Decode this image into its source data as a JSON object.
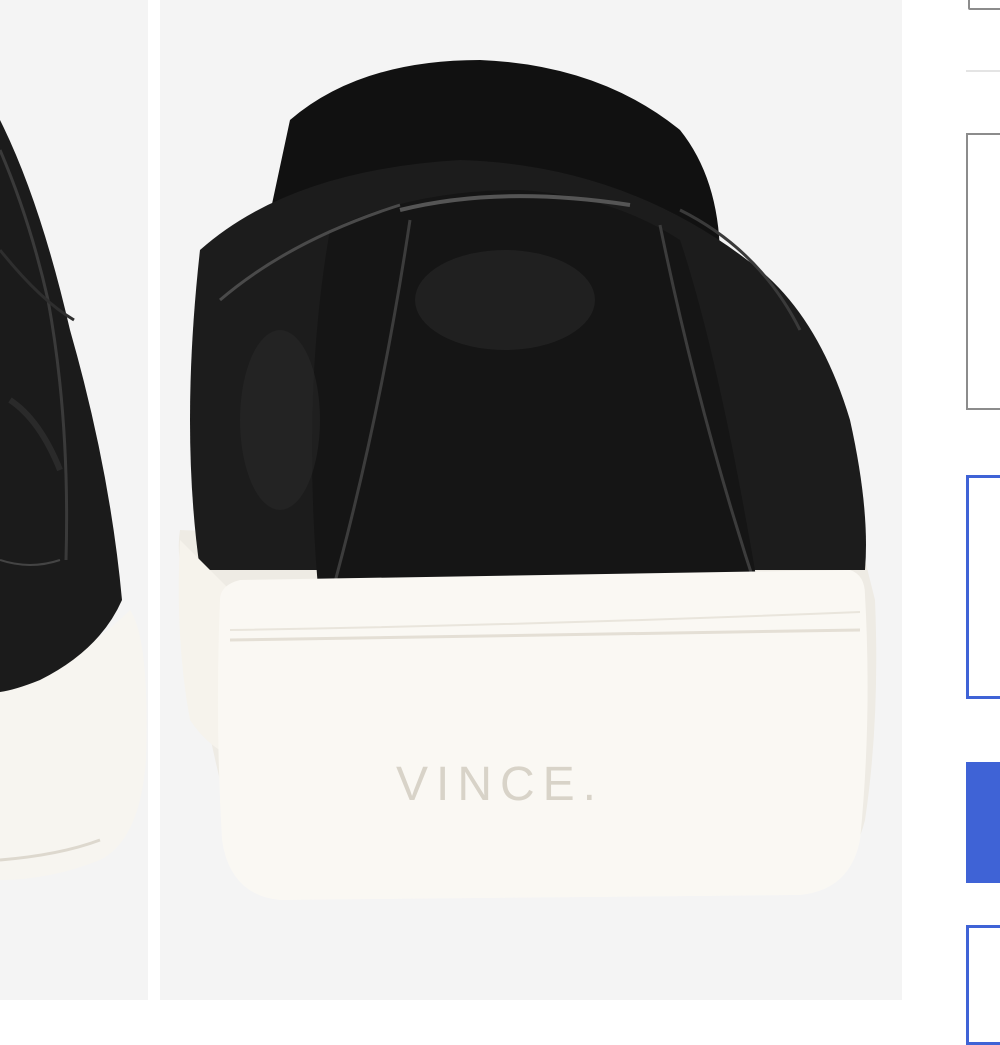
{
  "gallery": {
    "images": [
      {
        "name": "left-shoe-side-view",
        "color": "#1a1a1a"
      },
      {
        "name": "main-shoe-heel-view",
        "color": "#1a1a1a",
        "sole_color": "#f7f5f0"
      }
    ],
    "brand_logo_text": "VINCE."
  },
  "sidebar": {
    "accent_color": "#3f63d6",
    "border_color": "#8c8c8c"
  }
}
